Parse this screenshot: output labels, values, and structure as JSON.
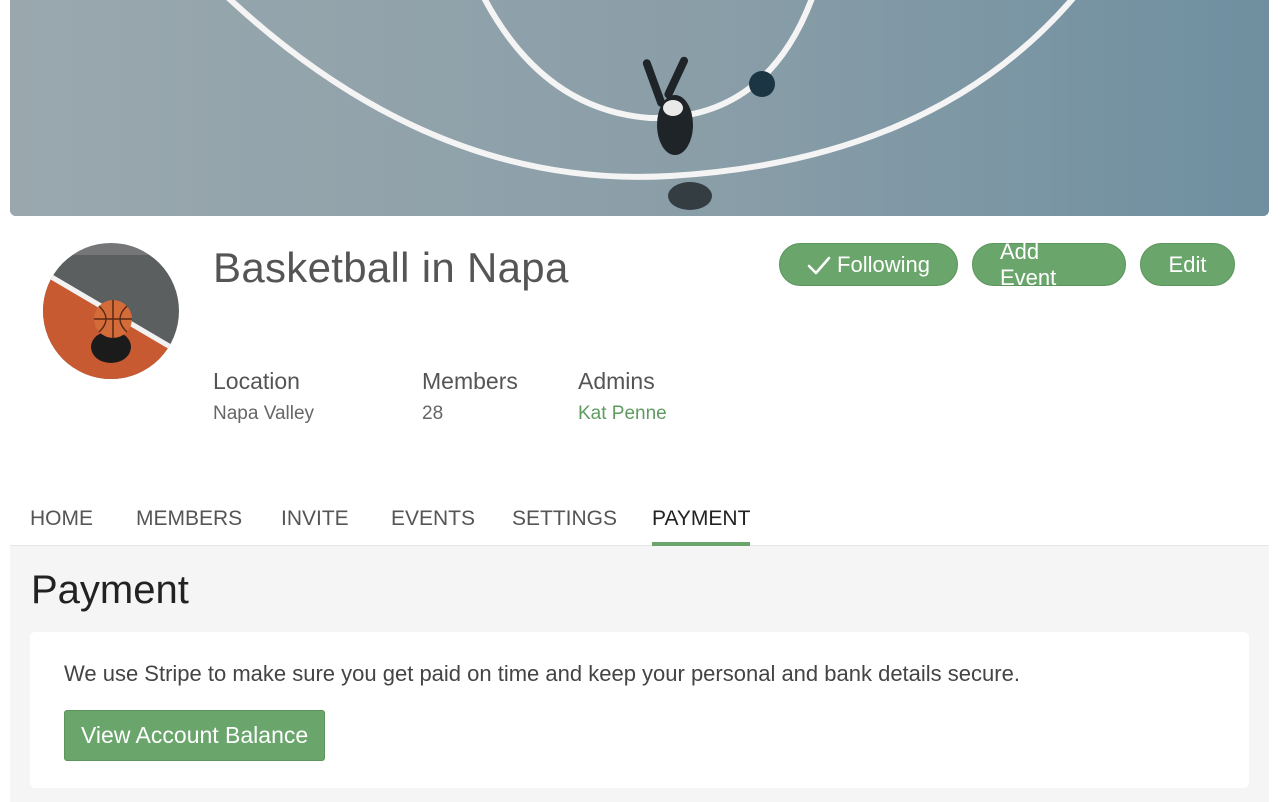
{
  "group": {
    "name": "Basketball in Napa",
    "meta": [
      {
        "label": "Location",
        "value": "Napa Valley",
        "is_link": false
      },
      {
        "label": "Members",
        "value": "28",
        "is_link": false
      },
      {
        "label": "Admins",
        "value": "Kat Penne",
        "is_link": true
      }
    ]
  },
  "actions": {
    "following_label": "Following",
    "add_event_label": "Add Event",
    "edit_label": "Edit"
  },
  "tabs": [
    {
      "label": "HOME"
    },
    {
      "label": "MEMBERS"
    },
    {
      "label": "INVITE"
    },
    {
      "label": "EVENTS"
    },
    {
      "label": "SETTINGS"
    },
    {
      "label": "PAYMENT",
      "active": true
    }
  ],
  "payment": {
    "title": "Payment",
    "description": "We use Stripe to make sure you get paid on time and keep your personal and bank details secure.",
    "button_label": "View Account Balance"
  },
  "colors": {
    "accent": "#6aa56b",
    "link": "#5e9b5f"
  },
  "icons": {
    "following": "check-icon"
  }
}
